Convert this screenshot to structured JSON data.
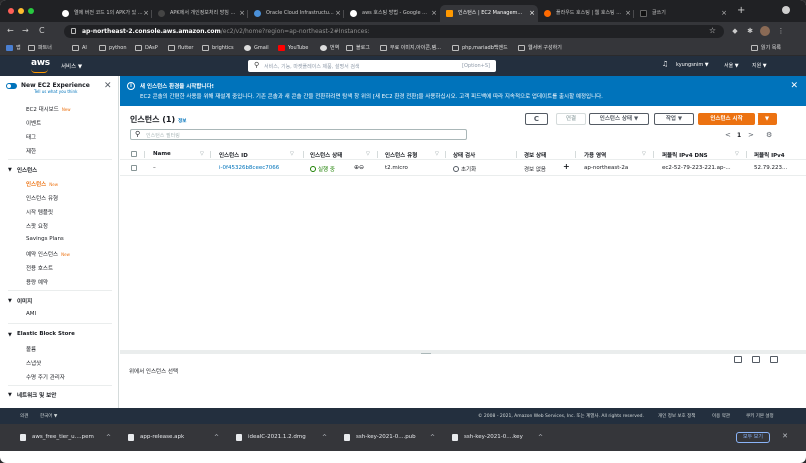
{
  "browser": {
    "tabs": [
      {
        "title": "엘에 버전 코드 1의 APK가 있 ...",
        "active": false,
        "favicon_color": "#ffffff"
      },
      {
        "title": "APK에서 개인정보처리 방침 ...",
        "active": false,
        "favicon_color": "#202124"
      },
      {
        "title": "Oracle Cloud Infrastructu...",
        "active": false,
        "favicon_color": "#4a90d9"
      },
      {
        "title": "aws 호스팅 방법 - Google ...",
        "active": false,
        "favicon_color": "#ffffff"
      },
      {
        "title": "인스턴스 | EC2 Managem...",
        "active": true,
        "favicon_color": "#ff9900"
      },
      {
        "title": "플라우드 호스팅 | 웹 호스팅 ...",
        "active": false,
        "favicon_color": "#ff6a00"
      },
      {
        "title": "글쓰기",
        "active": false,
        "favicon_color": "#222222"
      }
    ],
    "new_tab": "+",
    "url_host": "ap-northeast-2.console.aws.amazon.com",
    "url_path": "/ec2/v2/home?region=ap-northeast-2#Instances:",
    "bookmarks": [
      "앱",
      "파트너",
      "AI",
      "python",
      "DAsP",
      "flutter",
      "brightics",
      "Gmail",
      "YouTube",
      "번역",
      "블로그",
      "무료 이미지,아이콘,템...",
      "php,mariadb백엔드",
      "웹서버 구성하기"
    ],
    "reading_list": "읽기 목록"
  },
  "aws_nav": {
    "logo": "aws",
    "services": "서비스 ▼",
    "search_placeholder": "서비스, 기능, 마켓플레이스 제품, 설명서 검색",
    "search_shortcut": "[Option+S]",
    "user": "kyungsnim ▼",
    "region": "서울 ▼",
    "support": "지원 ▼"
  },
  "sidebar": {
    "experience_title": "New EC2 Experience",
    "experience_sub": "Tell us what you think",
    "close": "✕",
    "dashboard": "EC2 대시보드",
    "new_badge": "New",
    "events": "이벤트",
    "tags": "태그",
    "limits": "제한",
    "sec_instances": "인스턴스",
    "instances": [
      "인스턴스",
      "인스턴스 유형",
      "시작 템플릿",
      "스팟 요청",
      "Savings Plans",
      "예약 인스턴스",
      "전용 호스트",
      "용량 예약"
    ],
    "sec_images": "이미지",
    "images": [
      "AMI"
    ],
    "sec_ebs": "Elastic Block Store",
    "ebs": [
      "볼륨",
      "스냅샷",
      "수명 주기 관리자"
    ],
    "sec_network": "네트워크 및 보안"
  },
  "banner": {
    "info": "i",
    "title": "새 인스턴스 환경을 시작합니다!",
    "body": "EC2 콘솔의 간편한 사용을 위해 재설계 중입니다. 기존 콘솔과 새 콘솔 간을 전환하려면 탐색 창 위의 [새 EC2 환경 전환]을 사용하십시오. 고객 피드백에 따라 지속적으로 업데이트를 출시할 예정입니다.",
    "close": "✕"
  },
  "instances_panel": {
    "title": "인스턴스",
    "count": "(1)",
    "info": "정보",
    "refresh": "C",
    "connect": "연결",
    "state_btn": "인스턴스 상태 ▼",
    "actions_btn": "작업 ▼",
    "launch_btn": "인스턴스 시작",
    "launch_arrow": "▼",
    "filter_placeholder": "인스턴스 필터링",
    "page_prev": "<",
    "page_num": "1",
    "page_next": ">",
    "settings": "⚙",
    "columns": [
      "Name",
      "인스턴스 ID",
      "인스턴스 상태",
      "인스턴스 유형",
      "상태 검사",
      "경보 상태",
      "가용 영역",
      "퍼블릭 IPv4 DNS",
      "퍼블릭 IPv4"
    ],
    "rows": [
      {
        "name": "–",
        "id": "i-0f45326b8ceec7066",
        "state": "실행 중",
        "type": "t2.micro",
        "check": "초기화",
        "alarm": "경보 없음",
        "add": "+",
        "az": "ap-northeast-2a",
        "dns": "ec2-52-79-223-221.ap-...",
        "ip": "52.79.223..."
      }
    ]
  },
  "detail": {
    "select_prompt": "위에서 인스턴스 선택"
  },
  "footer": {
    "lang_label": "의견",
    "lang": "한국어 ▼",
    "copyright": "© 2008 - 2021, Amazon Web Services, Inc. 또는 계열사. All rights reserved.",
    "privacy": "개인 정보 보호 정책",
    "terms": "이용 약관",
    "cookies": "쿠키 기본 설정"
  },
  "downloads": {
    "items": [
      "aws_free_tier_u....pem",
      "app-release.apk",
      "idealC-2021.1.2.dmg",
      "ssh-key-2021-0....pub",
      "ssh-key-2021-0....key"
    ],
    "show_all": "모두 보기",
    "close": "✕"
  },
  "colors": {
    "aws_orange": "#ec7211",
    "aws_navy": "#232f3e",
    "link_blue": "#0073bb",
    "success_green": "#1d8102"
  }
}
